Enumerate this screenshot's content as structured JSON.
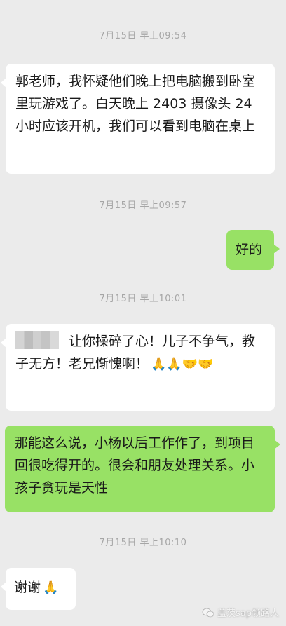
{
  "messages": [
    {
      "timestamp": "7月15日 早上09:54",
      "side": "left",
      "text": "郭老师，我怀疑他们晚上把电脑搬到卧室里玩游戏了。白天晚上 2403 摄像头 24 小时应该开机，我们可以看到电脑在桌上"
    },
    {
      "timestamp": "7月15日 早上09:57",
      "side": "right",
      "text": "好的"
    },
    {
      "timestamp": "7月15日 早上10:01",
      "side": "left",
      "text": "让你操碎了心！儿子不争气，教子无方！老兄惭愧啊！",
      "emojis": "🙏🙏🤝🤝"
    },
    {
      "side": "right",
      "text": "那能这么说，小杨以后工作作了，到项目回很吃得开的。很会和朋友处理关系。小孩子贪玩是天性"
    },
    {
      "timestamp": "7月15日 早上10:10",
      "side": "left",
      "text": "谢谢",
      "emojis": "🙏"
    }
  ],
  "watermark": "盖茨sap领路人"
}
